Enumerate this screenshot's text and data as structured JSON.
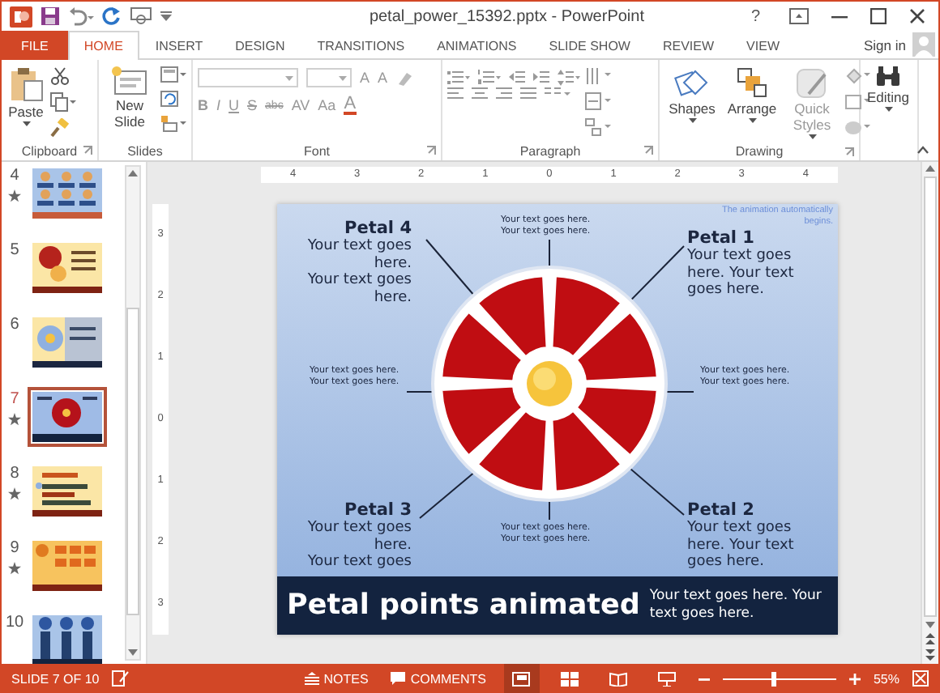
{
  "window": {
    "title": "petal_power_15392.pptx - PowerPoint",
    "help": "?"
  },
  "tabs": [
    {
      "label": "FILE",
      "kind": "file",
      "selected": false
    },
    {
      "label": "HOME",
      "kind": "tab",
      "selected": true
    },
    {
      "label": "INSERT",
      "kind": "tab",
      "selected": false
    },
    {
      "label": "DESIGN",
      "kind": "tab",
      "selected": false
    },
    {
      "label": "TRANSITIONS",
      "kind": "tab",
      "selected": false
    },
    {
      "label": "ANIMATIONS",
      "kind": "tab",
      "selected": false
    },
    {
      "label": "SLIDE SHOW",
      "kind": "tab",
      "selected": false
    },
    {
      "label": "REVIEW",
      "kind": "tab",
      "selected": false
    },
    {
      "label": "VIEW",
      "kind": "tab",
      "selected": false
    }
  ],
  "account": {
    "label": "Sign in"
  },
  "ribbon": {
    "clipboard": {
      "label": "Clipboard",
      "paste": "Paste"
    },
    "slides": {
      "label": "Slides",
      "new_slide": "New Slide"
    },
    "font": {
      "label": "Font",
      "size_buttons": [
        "A",
        "A"
      ],
      "buttons": [
        "B",
        "I",
        "U",
        "S",
        "abc",
        "AV",
        "Aa"
      ],
      "color_button": "A"
    },
    "paragraph": {
      "label": "Paragraph"
    },
    "drawing": {
      "label": "Drawing",
      "buttons": [
        "Shapes",
        "Arrange",
        "Quick Styles"
      ]
    },
    "editing": {
      "label": "Editing"
    }
  },
  "thumbnails": [
    {
      "number": "4",
      "kind": "grid",
      "animated": true,
      "selected": false
    },
    {
      "number": "5",
      "kind": "flower",
      "animated": false,
      "selected": false
    },
    {
      "number": "6",
      "kind": "wheel",
      "animated": false,
      "selected": false
    },
    {
      "number": "7",
      "kind": "petal",
      "animated": true,
      "selected": true
    },
    {
      "number": "8",
      "kind": "bars",
      "animated": true,
      "selected": false
    },
    {
      "number": "9",
      "kind": "boxes",
      "animated": true,
      "selected": false
    },
    {
      "number": "10",
      "kind": "towers",
      "animated": false,
      "selected": false
    }
  ],
  "rulers": {
    "horizontal": [
      "4",
      "3",
      "2",
      "1",
      "0",
      "1",
      "2",
      "3",
      "4"
    ],
    "vertical": [
      "3",
      "2",
      "1",
      "0",
      "1",
      "2",
      "3"
    ]
  },
  "slide": {
    "note": "The animation automatically begins.",
    "callouts": [
      {
        "kind": "petal",
        "title": "Petal 4",
        "paragraphs": [
          "Your text goes here.",
          "Your text goes here."
        ]
      },
      {
        "kind": "small",
        "paragraphs": [
          "Your text goes here. Your text goes here."
        ]
      },
      {
        "kind": "petal",
        "title": "Petal 1",
        "paragraphs": [
          "Your text goes here. Your text goes here."
        ]
      },
      {
        "kind": "small",
        "paragraphs": [
          "Your text goes here. Your text goes here."
        ]
      },
      {
        "kind": "small",
        "paragraphs": [
          "Your text goes here. Your text goes here."
        ]
      },
      {
        "kind": "petal",
        "title": "Petal 3",
        "paragraphs": [
          "Your text goes here.",
          "Your text goes"
        ]
      },
      {
        "kind": "small",
        "paragraphs": [
          "Your text goes here. Your text goes here."
        ]
      },
      {
        "kind": "petal",
        "title": "Petal 2",
        "paragraphs": [
          "Your text goes here. Your text goes here."
        ]
      }
    ],
    "banner": {
      "title": "Petal points animated",
      "text": "Your text goes here. Your text goes here."
    }
  },
  "status": {
    "slide": "SLIDE 7 OF 10",
    "notes": "NOTES",
    "comments": "COMMENTS",
    "views": [
      {
        "kind": "normal",
        "selected": true
      },
      {
        "kind": "sorter",
        "selected": false
      },
      {
        "kind": "reading",
        "selected": false
      },
      {
        "kind": "show",
        "selected": false
      }
    ],
    "zoom_slider": {
      "level": 0.45
    },
    "zoom": "55%"
  }
}
